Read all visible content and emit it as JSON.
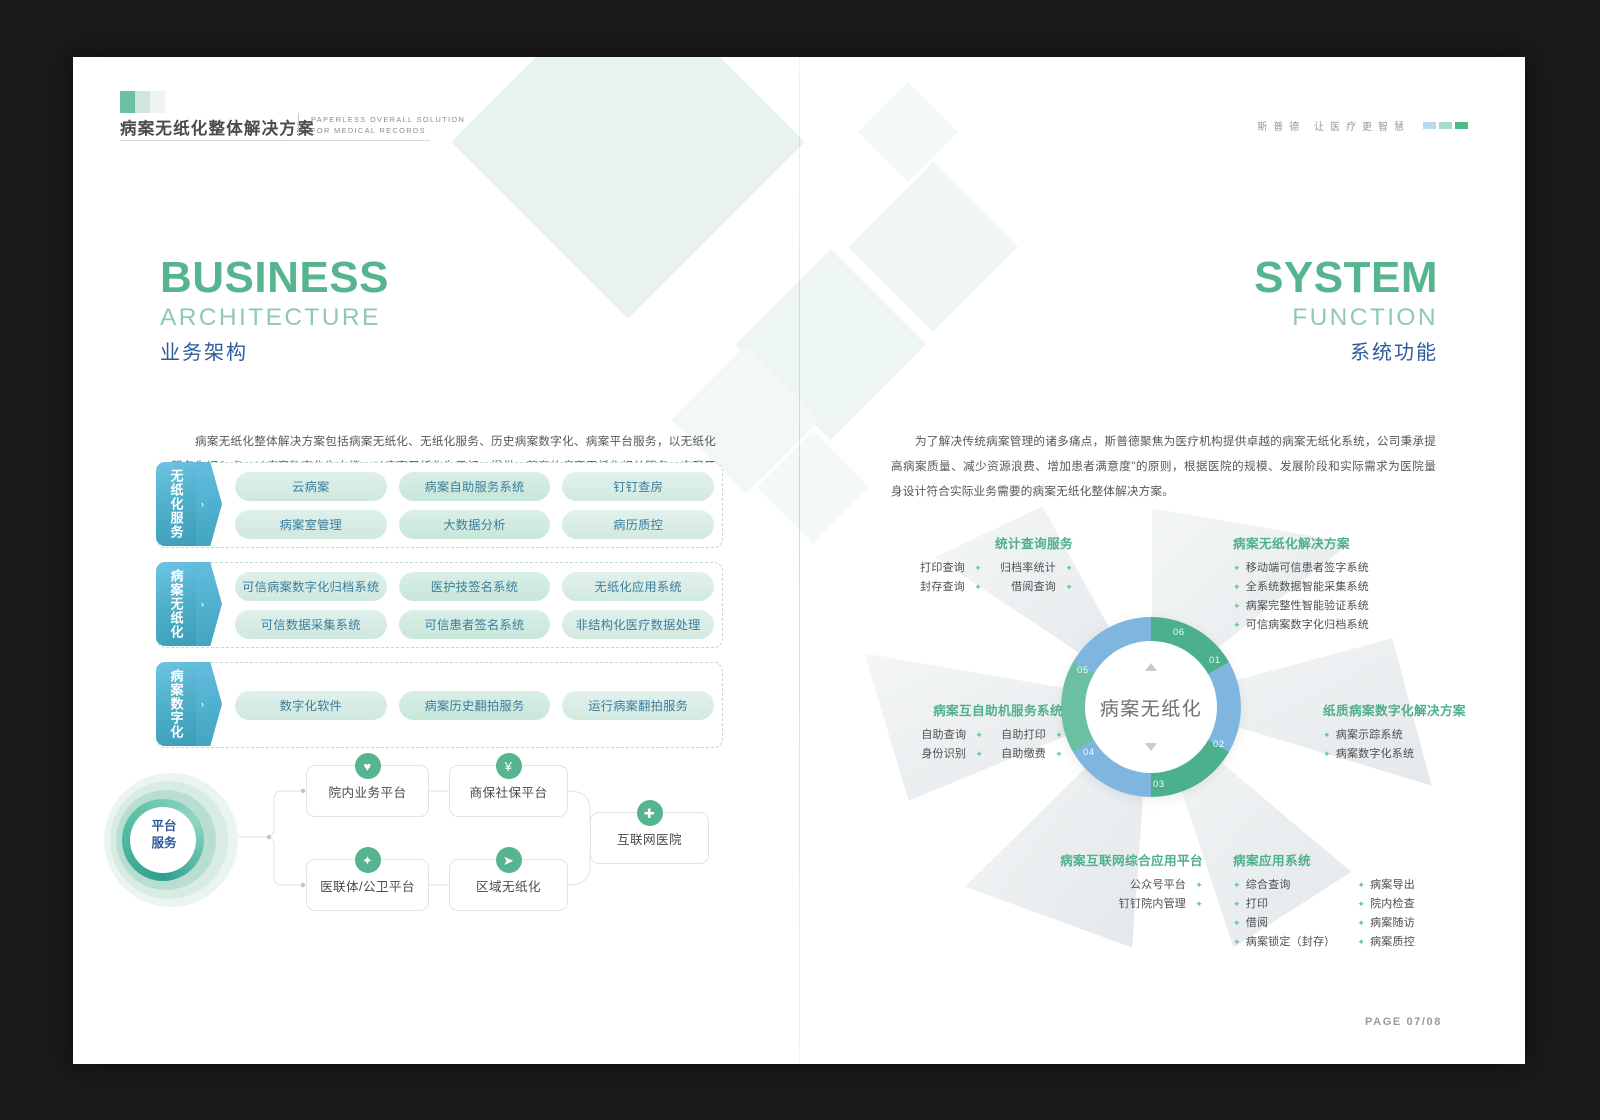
{
  "header": {
    "title_cn": "病案无纸化整体解决方案",
    "title_en_l1": "PAPERLESS  OVERALL  SOLUTION",
    "title_en_l2": "FOR  MEDICAL  RECORDS",
    "slogan": "斯普德 让医疗更智慧"
  },
  "left_page": {
    "title_main": "BUSINESS",
    "title_sub": "ARCHITECTURE",
    "title_cn": "业务架构",
    "paragraph": "病案无纸化整体解决方案包括病案无纸化、无纸化服务、历史病案数字化、病案平台服务，以无纸化服务为切入点，以病案数字化为支撑，以病案无纸化为目标，提供一整套的病案无纸化相关服务，实现无纸化最大产出结果：规范诊疗行为、提高医疗质量、优化医疗服务和提高患者安全及满意度，提升医院管理水准达到所能企及的新高度。",
    "blocks": [
      {
        "tag": "无纸化服务",
        "rows": [
          [
            "云病案",
            "病案自助服务系统",
            "钉钉查房"
          ],
          [
            "病案室管理",
            "大数据分析",
            "病历质控"
          ]
        ]
      },
      {
        "tag": "病案无纸化",
        "rows": [
          [
            "可信病案数字化归档系统",
            "医护技签名系统",
            "无纸化应用系统"
          ],
          [
            "可信数据采集系统",
            "可信患者签名系统",
            "非结构化医疗数据处理"
          ]
        ]
      },
      {
        "tag": "病案数字化",
        "rows": [
          [
            "数字化软件",
            "病案历史翻拍服务",
            "运行病案翻拍服务"
          ]
        ]
      }
    ],
    "flow": {
      "hub_line1": "平台",
      "hub_line2": "服务",
      "nodes": [
        {
          "label": "院内业务平台",
          "icon": "heart-icon",
          "glyph": "♥"
        },
        {
          "label": "商保社保平台",
          "icon": "yen-icon",
          "glyph": "¥"
        },
        {
          "label": "医联体/公卫平台",
          "icon": "sparkle-icon",
          "glyph": "✦"
        },
        {
          "label": "区域无纸化",
          "icon": "send-icon",
          "glyph": "➤"
        },
        {
          "label": "互联网医院",
          "icon": "plus-icon",
          "glyph": "✚"
        }
      ]
    }
  },
  "right_page": {
    "title_main": "SYSTEM",
    "title_sub": "FUNCTION",
    "title_cn": "系统功能",
    "paragraph": "为了解决传统病案管理的诸多痛点，斯普德聚焦为医疗机构提供卓越的病案无纸化系统，公司秉承提高病案质量、减少资源浪费、增加患者满意度\"的原则，根据医院的规模、发展阶段和实际需求为医院量身设计符合实际业务需要的病案无纸化整体解决方案。",
    "radial": {
      "center_label": "病案无纸化",
      "numbers": [
        "01",
        "02",
        "03",
        "04",
        "05",
        "06"
      ],
      "sections": [
        {
          "id": "statistics",
          "heading": "统计查询服务",
          "columns": [
            [
              "打印查询",
              "封存查询"
            ],
            [
              "归档率统计",
              "借阅查询"
            ]
          ]
        },
        {
          "id": "paperless-solution",
          "heading": "病案无纸化解决方案",
          "columns": [
            [
              "移动端可信患者签字系统",
              "全系统数据智能采集系统",
              "病案完整性智能验证系统",
              "可信病案数字化归档系统"
            ]
          ]
        },
        {
          "id": "paper-digitization",
          "heading": "纸质病案数字化解决方案",
          "columns": [
            [
              "病案示踪系统",
              "病案数字化系统"
            ]
          ]
        },
        {
          "id": "app-system",
          "heading": "病案应用系统",
          "columns": [
            [
              "综合查询",
              "打印",
              "借阅",
              "病案锁定（封存）"
            ],
            [
              "病案导出",
              "院内检查",
              "病案随访",
              "病案质控"
            ]
          ]
        },
        {
          "id": "internet-platform",
          "heading": "病案互联网综合应用平台",
          "columns": [
            [
              "公众号平台",
              "钉钉院内管理"
            ]
          ]
        },
        {
          "id": "kiosk-system",
          "heading": "病案互自助机服务系统",
          "columns": [
            [
              "自助查询",
              "身份识别"
            ],
            [
              "自助打印",
              "自助缴费"
            ]
          ]
        }
      ]
    }
  },
  "footer": {
    "page": "PAGE  07/08"
  },
  "colors": {
    "green": "#56b48f",
    "teal": "#4fb08c",
    "blue": "#2f5b9e",
    "sky": "#7fb6e0",
    "tag": "#4fb0c9"
  }
}
